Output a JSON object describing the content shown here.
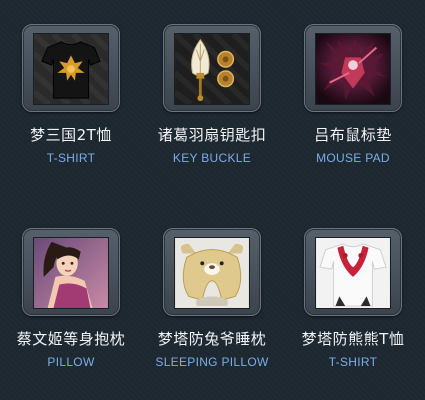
{
  "products": [
    {
      "title": "梦三国2T恤",
      "subtitle": "T-SHIRT",
      "image": "black-tshirt-emblem-image"
    },
    {
      "title": "诸葛羽扇钥匙扣",
      "subtitle": "KEY BUCKLE",
      "image": "feather-fan-keychain-image"
    },
    {
      "title": "吕布鼠标垫",
      "subtitle": "MOUSE PAD",
      "image": "warrior-mousepad-image"
    },
    {
      "title": "蔡文姬等身抱枕",
      "subtitle": "PILLOW",
      "image": "character-pillow-image"
    },
    {
      "title": "梦塔防兔爷睡枕",
      "subtitle": "SLEEPING PILLOW",
      "image": "rabbit-neck-pillow-image"
    },
    {
      "title": "梦塔防熊熊T恤",
      "subtitle": "T-SHIRT",
      "image": "white-tshirt-bear-image"
    }
  ]
}
